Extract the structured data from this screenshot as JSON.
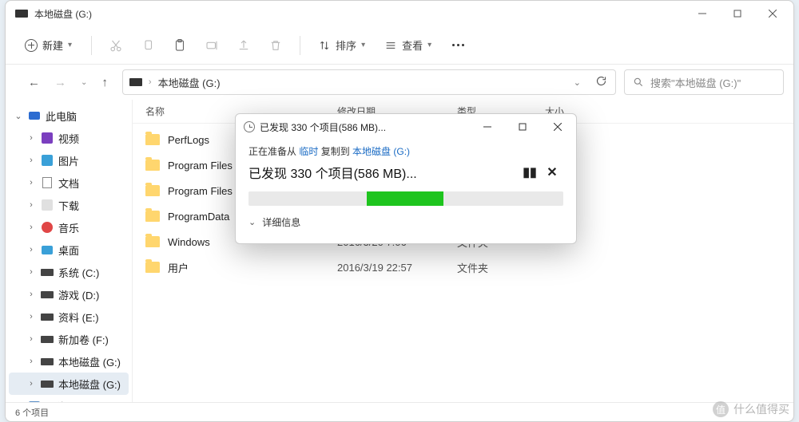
{
  "window": {
    "title": "本地磁盘 (G:)"
  },
  "toolbar": {
    "new_label": "新建",
    "sort_label": "排序",
    "view_label": "查看"
  },
  "address": {
    "path": "本地磁盘 (G:)"
  },
  "search": {
    "placeholder": "搜索\"本地磁盘 (G:)\""
  },
  "sidebar": {
    "this_pc": "此电脑",
    "videos": "视频",
    "pictures": "图片",
    "documents": "文档",
    "downloads": "下载",
    "music": "音乐",
    "desktop": "桌面",
    "drive_c": "系统 (C:)",
    "drive_d": "游戏 (D:)",
    "drive_e": "资料 (E:)",
    "drive_f": "新加卷 (F:)",
    "drive_g1": "本地磁盘 (G:)",
    "drive_g2": "本地磁盘 (G:)",
    "network": "网络"
  },
  "columns": {
    "name": "名称",
    "date": "修改日期",
    "type": "类型",
    "size": "大小"
  },
  "files": [
    {
      "name": "PerfLogs",
      "date": "",
      "type": ""
    },
    {
      "name": "Program Files",
      "date": "",
      "type": ""
    },
    {
      "name": "Program Files (x",
      "date": "",
      "type": ""
    },
    {
      "name": "ProgramData",
      "date": "",
      "type": ""
    },
    {
      "name": "Windows",
      "date": "2016/3/20 7:06",
      "type": "文件夹"
    },
    {
      "name": "用户",
      "date": "2016/3/19 22:57",
      "type": "文件夹"
    }
  ],
  "status": {
    "count": "6 个项目"
  },
  "dialog": {
    "title": "已发现 330 个项目(586 MB)...",
    "sub_prefix": "正在准备从 ",
    "sub_src": "临时",
    "sub_mid": " 复制到 ",
    "sub_dst": "本地磁盘 (G:)",
    "main": "已发现 330 个项目(586 MB)...",
    "more": "详细信息"
  },
  "watermark": {
    "text": "什么值得买",
    "badge": "值"
  }
}
